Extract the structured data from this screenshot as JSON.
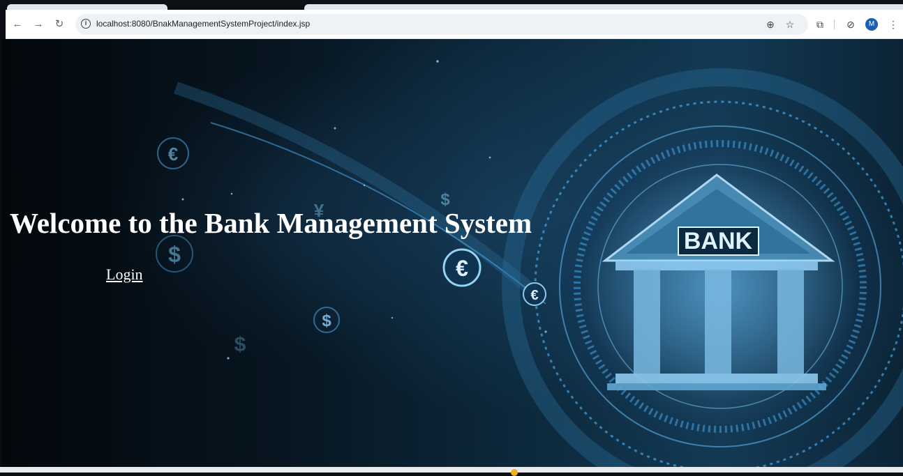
{
  "browser": {
    "url": "localhost:8080/BnakManagementSystemProject/index.jsp",
    "profile_initial": "M",
    "icons": [
      "back-icon",
      "forward-icon",
      "reload-icon",
      "site-info-icon",
      "zoom-icon",
      "bookmark-star-icon",
      "extensions-icon",
      "sync-icon",
      "menu-icon"
    ]
  },
  "page": {
    "heading": "Welcome to the Bank Management System",
    "login_link": "Login",
    "image_sign_text": "BANK",
    "currency_symbols": [
      "€",
      "$",
      "¥",
      "$",
      "€",
      "€",
      "$",
      "$"
    ]
  },
  "colors": {
    "heading": "#ffffff",
    "accent_blue": "#4fb8ff",
    "avatar": "#1a5fb4"
  }
}
